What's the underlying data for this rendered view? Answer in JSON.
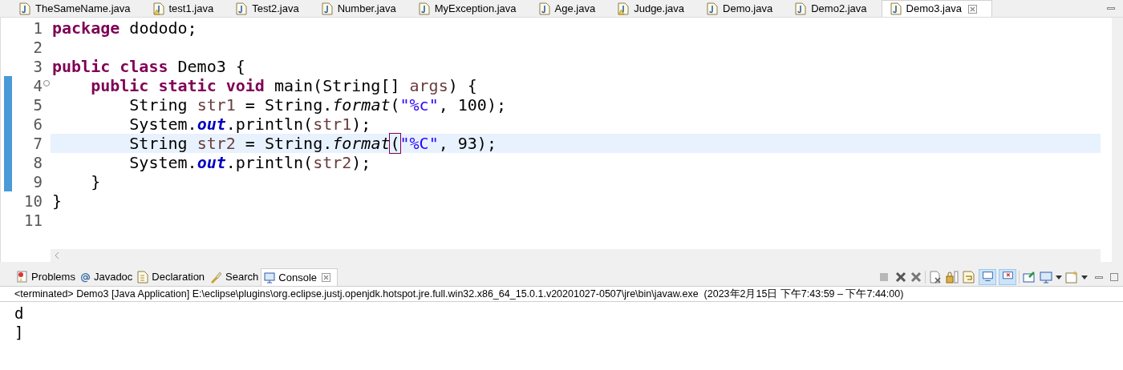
{
  "editor_tabs": [
    {
      "label": "TheSameName.java",
      "selected": false,
      "warning": false
    },
    {
      "label": "test1.java",
      "selected": false,
      "warning": true
    },
    {
      "label": "Test2.java",
      "selected": false,
      "warning": false
    },
    {
      "label": "Number.java",
      "selected": false,
      "warning": false
    },
    {
      "label": "MyException.java",
      "selected": false,
      "warning": false
    },
    {
      "label": "Age.java",
      "selected": false,
      "warning": false
    },
    {
      "label": "Judge.java",
      "selected": false,
      "warning": true
    },
    {
      "label": "Demo.java",
      "selected": false,
      "warning": false
    },
    {
      "label": "Demo2.java",
      "selected": false,
      "warning": false
    },
    {
      "label": "Demo3.java",
      "selected": true,
      "warning": false
    }
  ],
  "code_lines": [
    {
      "number": "1",
      "changed": false,
      "foldable": false,
      "highlighted": false,
      "tokens": [
        {
          "text": "package",
          "kind": "keyword"
        },
        {
          "text": " dododo;",
          "kind": "plain"
        }
      ]
    },
    {
      "number": "2",
      "changed": false,
      "foldable": false,
      "highlighted": false
    },
    {
      "number": "3",
      "changed": false,
      "foldable": false,
      "highlighted": false,
      "tokens": [
        {
          "text": "public class",
          "kind": "keyword"
        },
        {
          "text": " Demo3 {",
          "kind": "plain"
        }
      ]
    },
    {
      "number": "4",
      "changed": true,
      "foldable": true,
      "highlighted": false,
      "tokens": [
        {
          "text": "    public static void",
          "kind": "keyword"
        },
        {
          "text": " main(String[] ",
          "kind": "plain"
        },
        {
          "text": "args",
          "kind": "variable"
        },
        {
          "text": ") {",
          "kind": "plain"
        }
      ]
    },
    {
      "number": "5",
      "changed": true,
      "foldable": false,
      "highlighted": false,
      "tokens": [
        {
          "text": "        String ",
          "kind": "plain"
        },
        {
          "text": "str1",
          "kind": "variable"
        },
        {
          "text": " = String.",
          "kind": "plain"
        },
        {
          "text": "format",
          "kind": "static-method"
        },
        {
          "text": "(",
          "kind": "plain"
        },
        {
          "text": "\"%c\"",
          "kind": "string"
        },
        {
          "text": ", 100);",
          "kind": "plain"
        }
      ]
    },
    {
      "number": "6",
      "changed": true,
      "foldable": false,
      "highlighted": false,
      "tokens": [
        {
          "text": "        System.",
          "kind": "plain"
        },
        {
          "text": "out",
          "kind": "static-field"
        },
        {
          "text": ".println(",
          "kind": "plain"
        },
        {
          "text": "str1",
          "kind": "variable"
        },
        {
          "text": ");",
          "kind": "plain"
        }
      ]
    },
    {
      "number": "7",
      "changed": true,
      "foldable": false,
      "highlighted": true,
      "tokens": [
        {
          "text": "        String ",
          "kind": "plain"
        },
        {
          "text": "str2",
          "kind": "variable"
        },
        {
          "text": " = String.",
          "kind": "plain"
        },
        {
          "text": "format",
          "kind": "static-method"
        },
        {
          "text": "(",
          "kind": "bracket-match"
        },
        {
          "text": "\"%C\"",
          "kind": "string"
        },
        {
          "text": ", 93);",
          "kind": "plain"
        }
      ]
    },
    {
      "number": "8",
      "changed": true,
      "foldable": false,
      "highlighted": false,
      "tokens": [
        {
          "text": "        System.",
          "kind": "plain"
        },
        {
          "text": "out",
          "kind": "static-field"
        },
        {
          "text": ".println(",
          "kind": "plain"
        },
        {
          "text": "str2",
          "kind": "variable"
        },
        {
          "text": ");",
          "kind": "plain"
        }
      ]
    },
    {
      "number": "9",
      "changed": true,
      "foldable": false,
      "highlighted": false,
      "tokens": [
        {
          "text": "    }",
          "kind": "plain"
        }
      ]
    },
    {
      "number": "10",
      "changed": false,
      "foldable": false,
      "highlighted": false,
      "tokens": [
        {
          "text": "}",
          "kind": "plain"
        }
      ]
    },
    {
      "number": "11",
      "changed": false,
      "foldable": false,
      "highlighted": false
    }
  ],
  "view_tabs": [
    {
      "label": "Problems",
      "selected": false,
      "kind": "problems"
    },
    {
      "label": "Javadoc",
      "selected": false,
      "kind": "javadoc"
    },
    {
      "label": "Declaration",
      "selected": false,
      "kind": "declaration"
    },
    {
      "label": "Search",
      "selected": false,
      "kind": "search"
    },
    {
      "label": "Console",
      "selected": true,
      "kind": "console"
    }
  ],
  "console_header": "<terminated> Demo3 [Java Application] E:\\eclipse\\plugins\\org.eclipse.justj.openjdk.hotspot.jre.full.win32.x86_64_15.0.1.v20201027-0507\\jre\\bin\\javaw.exe  (2023年2月15日 下午7:43:59 – 下午7:44:00)",
  "console_output": [
    "d",
    "]"
  ]
}
